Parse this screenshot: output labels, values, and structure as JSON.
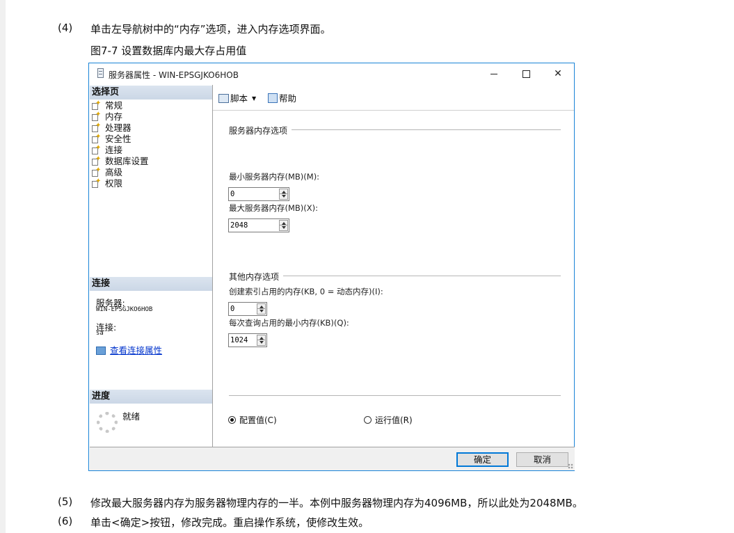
{
  "doc": {
    "step4": {
      "num": "(4)",
      "text": "单击左导航树中的“内存”选项，进入内存选项界面。"
    },
    "caption": "图7-7 设置数据库内最大存占用值",
    "step5": {
      "num": "(5)",
      "text": "修改最大服务器内存为服务器物理内存的一半。本例中服务器物理内存为4096MB，所以此处为2048MB。"
    },
    "step6": {
      "num": "(6)",
      "text": "单击<确定>按钮，修改完成。重启操作系统，使修改生效。"
    }
  },
  "window": {
    "title": "服务器属性 - WIN-EPSGJKO6HOB",
    "minimize": "—",
    "close": "✕"
  },
  "sidebar": {
    "select_page_header": "选择页",
    "items": [
      {
        "label": "常规",
        "icon": "page-icon"
      },
      {
        "label": "内存",
        "icon": "page-icon"
      },
      {
        "label": "处理器",
        "icon": "page-icon"
      },
      {
        "label": "安全性",
        "icon": "page-icon"
      },
      {
        "label": "连接",
        "icon": "page-icon"
      },
      {
        "label": "数据库设置",
        "icon": "page-icon"
      },
      {
        "label": "高级",
        "icon": "page-icon"
      },
      {
        "label": "权限",
        "icon": "page-icon"
      }
    ],
    "connection_header": "连接",
    "server_label": "服务器:",
    "server_value": "WIN-EPSGJKO6HOB",
    "connection_label": "连接:",
    "connection_value": "sa",
    "view_link": "查看连接属性",
    "progress_header": "进度",
    "progress_status": "就绪"
  },
  "toolbar": {
    "script_label": "脚本",
    "dropdown_arrow": "▼",
    "help_label": "帮助"
  },
  "memory": {
    "server_memory_group": "服务器内存选项",
    "min_label": "最小服务器内存(MB)(M):",
    "min_value": "0",
    "max_label": "最大服务器内存(MB)(X):",
    "max_value": "2048",
    "other_group": "其他内存选项",
    "index_label": "创建索引占用的内存(KB, 0 = 动态内存)(I):",
    "index_value": "0",
    "query_label": "每次查询占用的最小内存(KB)(Q):",
    "query_value": "1024",
    "radio_configured": "配置值(C)",
    "radio_running": "运行值(R)"
  },
  "buttons": {
    "ok": "确定",
    "cancel": "取消"
  }
}
